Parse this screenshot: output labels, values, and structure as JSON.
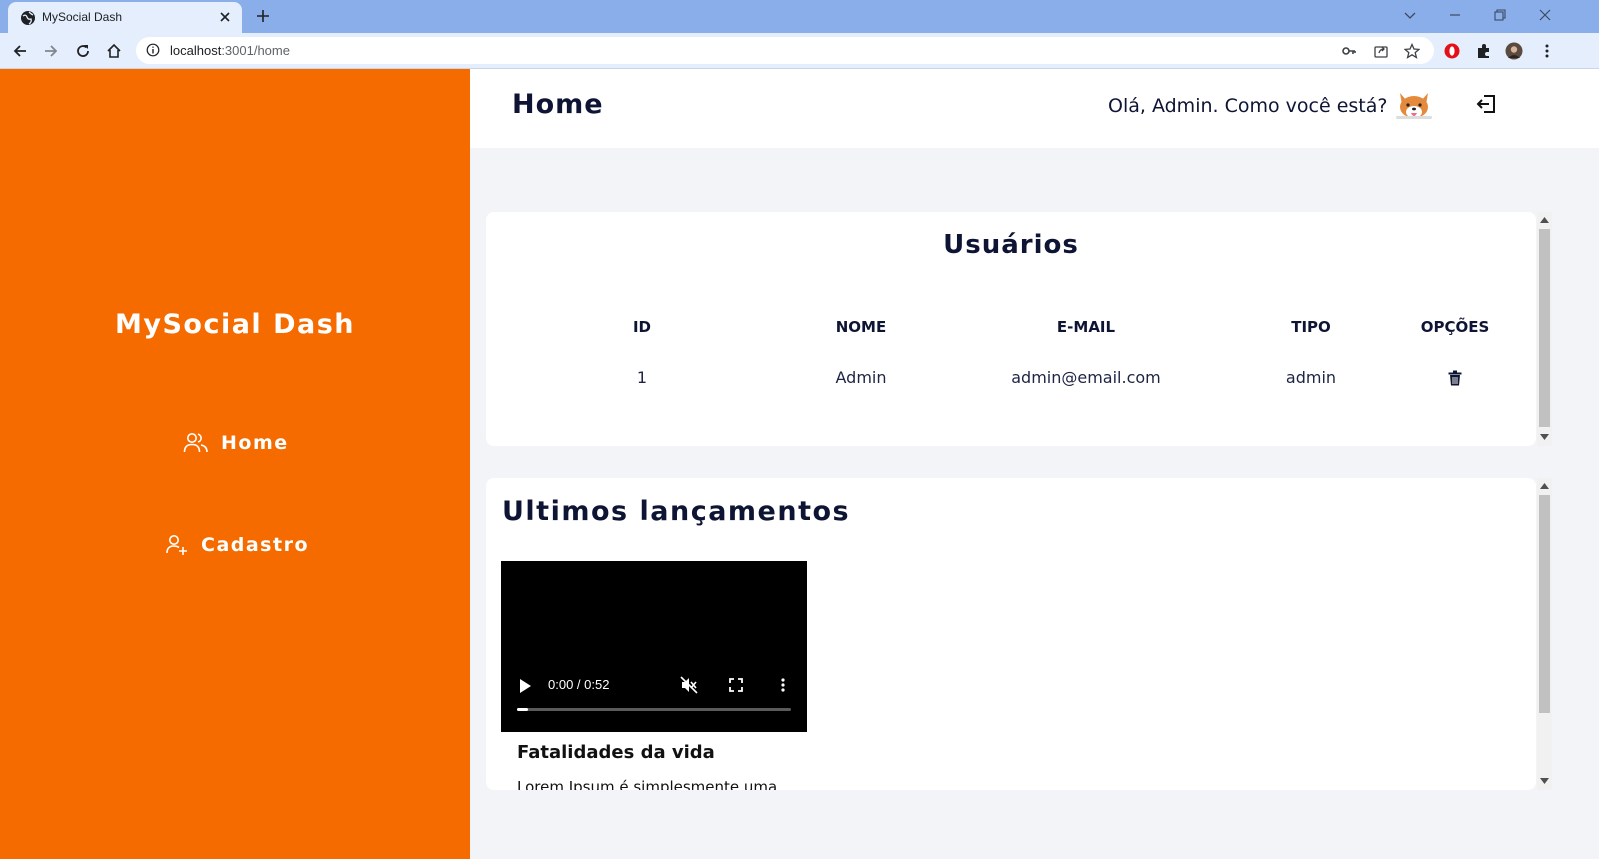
{
  "browser": {
    "tab_title": "MySocial Dash",
    "url_host": "localhost",
    "url_path": ":3001/home"
  },
  "sidebar": {
    "brand": "MySocial Dash",
    "items": [
      {
        "label": "Home",
        "icon": "users-icon"
      },
      {
        "label": "Cadastro",
        "icon": "user-add-icon"
      }
    ],
    "color": "#f56b00"
  },
  "header": {
    "title": "Home",
    "greeting": "Olá, Admin. Como você está?",
    "avatar_icon": "corgi-icon",
    "logout_icon": "logout-icon"
  },
  "users": {
    "title": "Usuários",
    "columns": [
      "ID",
      "NOME",
      "E-MAIL",
      "TIPO",
      "OPÇÕES"
    ],
    "rows": [
      {
        "id": "1",
        "name": "Admin",
        "email": "admin@email.com",
        "type": "admin",
        "action_icon": "trash-icon"
      }
    ]
  },
  "releases": {
    "title": "Ultimos lançamentos",
    "videos": [
      {
        "time": "0:00 / 0:52",
        "progress": 0.04,
        "title": "Fatalidades da vida",
        "description": "Lorem Ipsum é simplesmente uma"
      }
    ]
  },
  "colors": {
    "accent": "#f56b00",
    "text_dark": "#0e1433",
    "background": "#f3f4f8"
  }
}
